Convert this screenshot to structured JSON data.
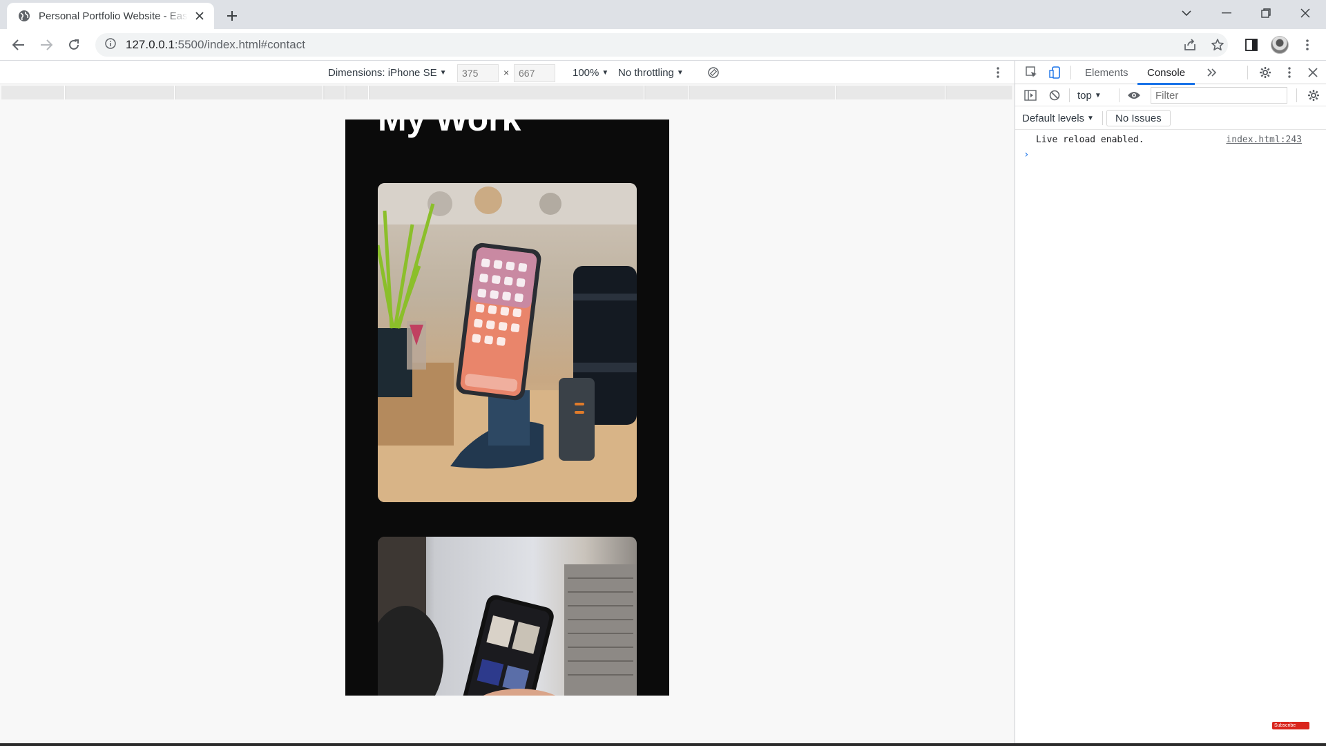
{
  "tab": {
    "title": "Personal Portfolio Website - Easy"
  },
  "address": {
    "host": "127.0.0.1",
    "rest": ":5500/index.html#contact"
  },
  "device_toolbar": {
    "dimensions_label": "Dimensions: iPhone SE",
    "width_value": "375",
    "times": "×",
    "height_value": "667",
    "zoom": "100%",
    "throttling": "No throttling"
  },
  "page": {
    "section_heading": "My Work"
  },
  "devtools": {
    "tabs": [
      "Elements",
      "Console"
    ],
    "active_tab": "Console",
    "context": "top",
    "filter_placeholder": "Filter",
    "levels": "Default levels",
    "issues": "No Issues",
    "console_message": "Live reload enabled.",
    "console_source": "index.html:243",
    "prompt": "›"
  },
  "overlay": {
    "badge": "Subscribe"
  },
  "colors": {
    "accent": "#1a73e8",
    "page_bg": "#0b0b0b",
    "tabstrip": "#dee1e6"
  }
}
